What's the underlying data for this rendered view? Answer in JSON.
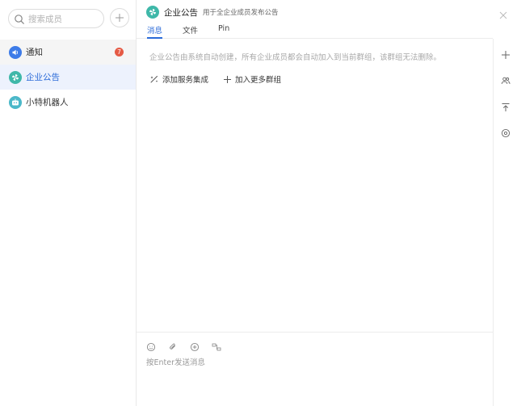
{
  "sidebar": {
    "search_placeholder": "搜索成员",
    "items": [
      {
        "label": "通知",
        "badge": "7",
        "icon": "speaker-icon",
        "color": "#3d7be8"
      },
      {
        "label": "企业公告",
        "icon": "pinwheel-icon",
        "color": "#3fb8a9"
      },
      {
        "label": "小特机器人",
        "icon": "robot-icon",
        "color": "#4bb8c9"
      }
    ]
  },
  "channel": {
    "title": "企业公告",
    "description": "用于全企业成员发布公告",
    "tabs": [
      "消息",
      "文件",
      "Pin"
    ],
    "notice": "企业公告由系统自动创建，所有企业成员都会自动加入到当前群组，该群组无法删除。",
    "actions": [
      "添加服务集成",
      "加入更多群组"
    ]
  },
  "composer": {
    "placeholder": "按Enter发送消息"
  },
  "colors": {
    "accent": "#2a6ad8",
    "badge": "#e55a45",
    "active_bg": "#edf2fd"
  }
}
